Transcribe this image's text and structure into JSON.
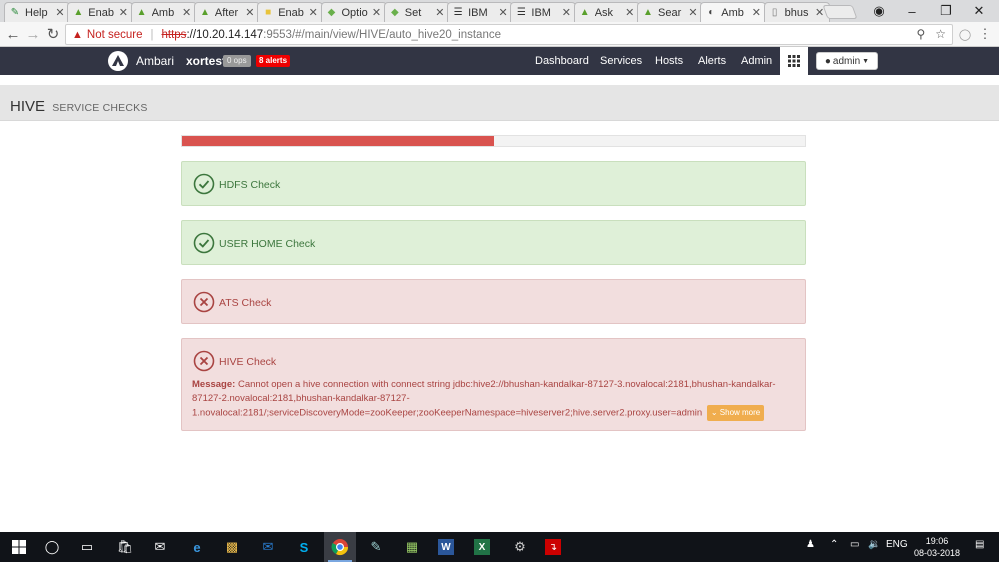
{
  "browser": {
    "tabs": [
      {
        "label": "Help",
        "icon": "pencil-icon",
        "active": false
      },
      {
        "label": "Enab",
        "icon": "hortonworks-icon",
        "active": false
      },
      {
        "label": "Amb",
        "icon": "hortonworks-icon",
        "active": false
      },
      {
        "label": "After",
        "icon": "hortonworks-icon",
        "active": false
      },
      {
        "label": "Enab",
        "icon": "yellow-doc-icon",
        "active": false
      },
      {
        "label": "Optio",
        "icon": "elephant-icon",
        "active": false
      },
      {
        "label": "Set",
        "icon": "elephant-icon",
        "active": false
      },
      {
        "label": "IBM",
        "icon": "ibm-icon",
        "active": false
      },
      {
        "label": "IBM",
        "icon": "ibm-icon",
        "active": false
      },
      {
        "label": "Ask",
        "icon": "hortonworks-icon",
        "active": false
      },
      {
        "label": "Sear",
        "icon": "hortonworks-icon",
        "active": false
      },
      {
        "label": "Amb",
        "icon": "ambari-icon",
        "active": true
      },
      {
        "label": "bhus",
        "icon": "page-icon",
        "active": false
      }
    ],
    "security_label": "Not secure",
    "url_protocol": "https",
    "url_host": "://10.20.14.147",
    "url_path": ":9553/#/main/view/HIVE/auto_hive20_instance"
  },
  "topnav": {
    "brand": "Ambari",
    "cluster": "xortest",
    "ops_badge": "0 ops",
    "alerts_badge": "8 alerts",
    "links": [
      "Dashboard",
      "Services",
      "Hosts",
      "Alerts",
      "Admin"
    ],
    "user_label": "admin"
  },
  "page": {
    "title": "HIVE",
    "subtitle": "SERVICE CHECKS",
    "progress_fraction": 0.5
  },
  "checks": [
    {
      "name": "HDFS Check",
      "status": "ok"
    },
    {
      "name": "USER HOME Check",
      "status": "ok"
    },
    {
      "name": "ATS Check",
      "status": "fail"
    },
    {
      "name": "HIVE Check",
      "status": "fail",
      "message_label": "Message:",
      "message_text": "Cannot open a hive connection with connect string jdbc:hive2://bhushan-kandalkar-87127-3.novalocal:2181,bhushan-kandalkar-87127-2.novalocal:2181,bhushan-kandalkar-87127-1.novalocal:2181/;serviceDiscoveryMode=zooKeeper;zooKeeperNamespace=hiveserver2;hive.server2.proxy.user=admin",
      "show_more_label": "Show more"
    }
  ],
  "taskbar": {
    "language": "ENG",
    "time": "19:06",
    "date": "08-03-2018"
  },
  "colors": {
    "navbar": "#323544",
    "success_bg": "#dff0d8",
    "success_text": "#3c763d",
    "danger_bg": "#f2dede",
    "danger_text": "#a94442",
    "progress_fill": "#d9534f",
    "warning_button": "#f0ad4e"
  }
}
